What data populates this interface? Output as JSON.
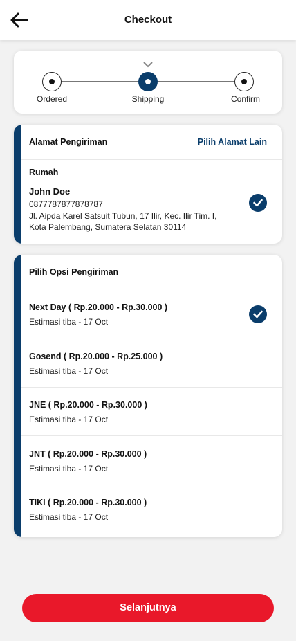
{
  "header": {
    "title": "Checkout"
  },
  "stepper": {
    "steps": [
      {
        "label": "Ordered"
      },
      {
        "label": "Shipping"
      },
      {
        "label": "Confirm"
      }
    ],
    "active_index": 1
  },
  "address": {
    "section_title": "Alamat Pengiriman",
    "change_link": "Pilih Alamat Lain",
    "label": "Rumah",
    "name": "John Doe",
    "phone": "0877787877878787",
    "line1": "Jl. Aipda Karel Satsuit Tubun, 17 Ilir, Kec. Ilir Tim. I,",
    "line2": "Kota Palembang, Sumatera Selatan 30114",
    "selected": true
  },
  "shipping": {
    "section_title": "Pilih Opsi Pengiriman",
    "options": [
      {
        "title": "Next Day ( Rp.20.000 - Rp.30.000 )",
        "eta": "Estimasi tiba - 17 Oct",
        "selected": true
      },
      {
        "title": "Gosend ( Rp.20.000 - Rp.25.000 )",
        "eta": "Estimasi tiba - 17 Oct",
        "selected": false
      },
      {
        "title": "JNE ( Rp.20.000 - Rp.30.000 )",
        "eta": "Estimasi tiba - 17 Oct",
        "selected": false
      },
      {
        "title": "JNT ( Rp.20.000 - Rp.30.000 )",
        "eta": "Estimasi tiba - 17 Oct",
        "selected": false
      },
      {
        "title": "TIKI ( Rp.20.000 - Rp.30.000 )",
        "eta": "Estimasi tiba - 17 Oct",
        "selected": false
      }
    ]
  },
  "footer": {
    "next_label": "Selanjutnya"
  },
  "colors": {
    "primary": "#0a3d6b",
    "accent_red": "#e9182a",
    "background": "#f2f2f2"
  }
}
